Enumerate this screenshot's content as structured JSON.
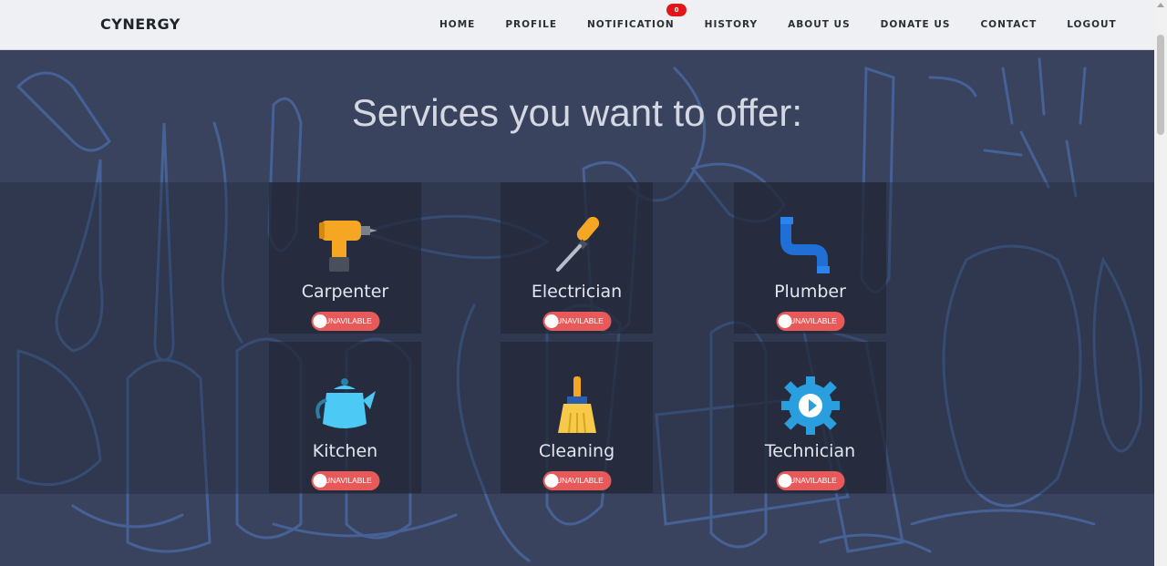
{
  "navbar": {
    "brand": "CYNERGY",
    "items": [
      {
        "label": "HOME"
      },
      {
        "label": "PROFILE"
      },
      {
        "label": "NOTIFICATION",
        "badge": "0"
      },
      {
        "label": "HISTORY"
      },
      {
        "label": "ABOUT US"
      },
      {
        "label": "DONATE US"
      },
      {
        "label": "CONTACT"
      },
      {
        "label": "LOGOUT"
      }
    ]
  },
  "main": {
    "title": "Services you want to offer:",
    "services": [
      {
        "label": "Carpenter",
        "status": "UNAVILABLE",
        "icon": "drill-icon"
      },
      {
        "label": "Electrician",
        "status": "UNAVILABLE",
        "icon": "screwdriver-icon"
      },
      {
        "label": "Plumber",
        "status": "UNAVILABLE",
        "icon": "pipe-icon"
      },
      {
        "label": "Kitchen",
        "status": "UNAVILABLE",
        "icon": "kettle-icon"
      },
      {
        "label": "Cleaning",
        "status": "UNAVILABLE",
        "icon": "broom-icon"
      },
      {
        "label": "Technician",
        "status": "UNAVILABLE",
        "icon": "gear-icon"
      }
    ]
  },
  "colors": {
    "background": "#39435e",
    "navbar": "#eef0f3",
    "toggle_off": "#e85a5a",
    "badge": "#e0161a"
  }
}
